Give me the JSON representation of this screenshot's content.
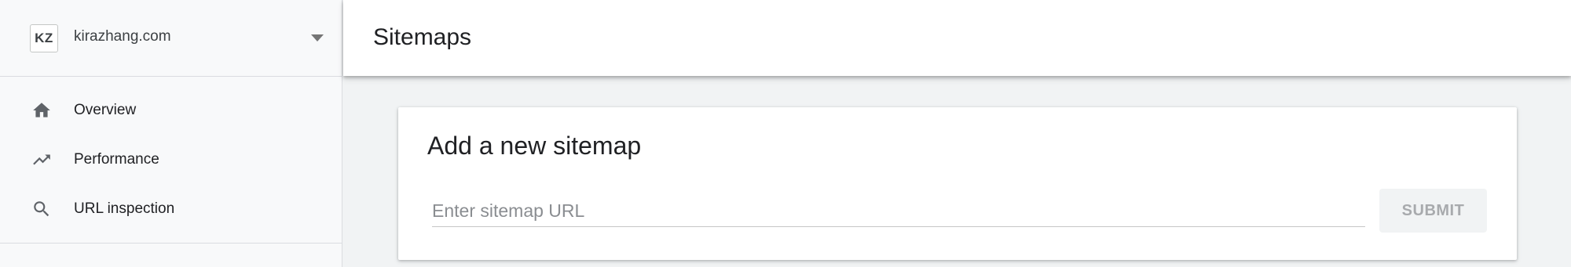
{
  "property": {
    "avatar_initials": "KZ",
    "name": "kirazhang.com"
  },
  "nav": {
    "items": [
      {
        "label": "Overview",
        "icon": "home-icon"
      },
      {
        "label": "Performance",
        "icon": "trending-up-icon"
      },
      {
        "label": "URL inspection",
        "icon": "search-icon"
      }
    ]
  },
  "header": {
    "title": "Sitemaps"
  },
  "card": {
    "title": "Add a new sitemap",
    "input_placeholder": "Enter sitemap URL",
    "input_value": "",
    "submit_label": "SUBMIT",
    "submit_disabled": true
  },
  "colors": {
    "sidebar_bg": "#f8f9fa",
    "page_bg": "#f1f3f4",
    "icon": "#5f6368",
    "disabled_text": "#a8aaad"
  }
}
